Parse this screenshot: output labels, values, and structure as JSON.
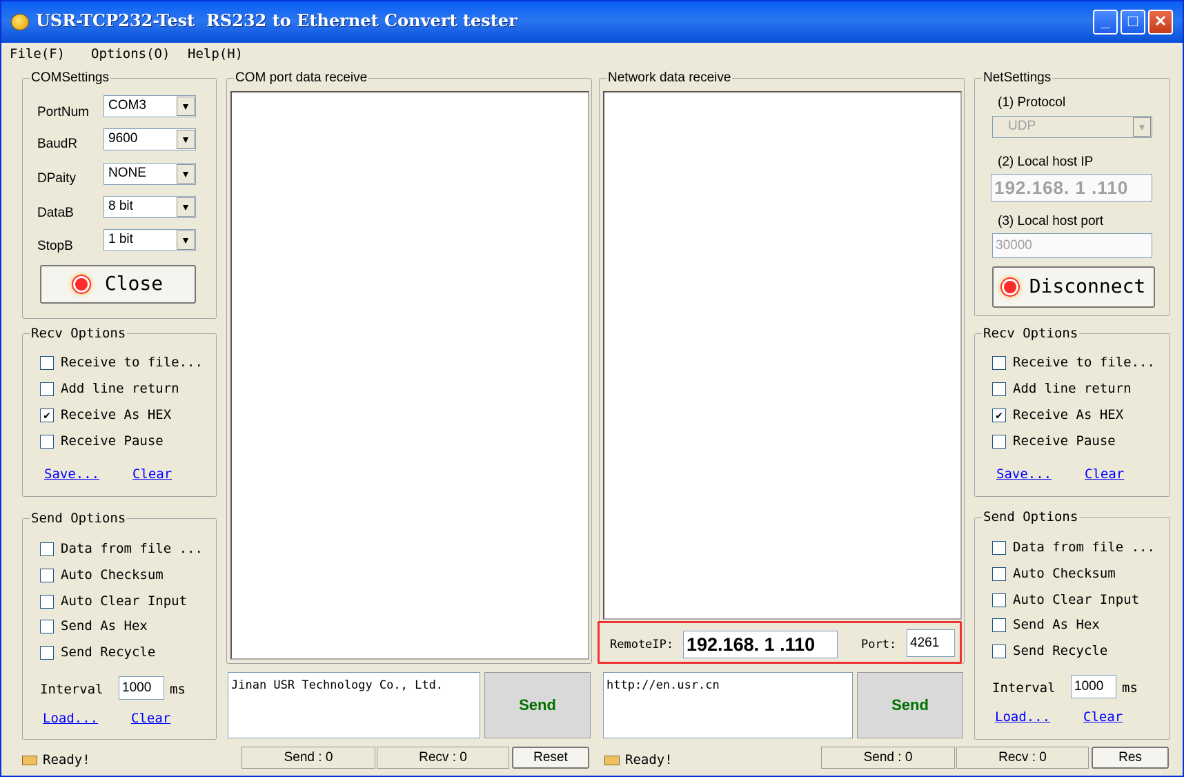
{
  "window": {
    "title": "USR-TCP232-Test  RS232 to Ethernet Convert tester",
    "minimize": "_",
    "maximize": "□",
    "close": "✕"
  },
  "menu": [
    "File(F)",
    "Options(O)",
    "Help(H)"
  ],
  "com_settings": {
    "legend": "COMSettings",
    "fields": [
      {
        "label": "PortNum",
        "value": "COM3"
      },
      {
        "label": "BaudR",
        "value": "9600"
      },
      {
        "label": "DPaity",
        "value": "NONE"
      },
      {
        "label": "DataB",
        "value": "8 bit"
      },
      {
        "label": "StopB",
        "value": "1 bit"
      }
    ],
    "button": "Close"
  },
  "com_recv_options": {
    "legend": "Recv Options",
    "items": [
      {
        "label": "Receive to file...",
        "checked": false
      },
      {
        "label": "Add line return",
        "checked": false
      },
      {
        "label": "Receive As HEX",
        "checked": true
      },
      {
        "label": "Receive Pause",
        "checked": false
      }
    ],
    "save": "Save...",
    "clear": "Clear"
  },
  "com_send_options": {
    "legend": "Send Options",
    "items": [
      {
        "label": "Data from file ...",
        "checked": false
      },
      {
        "label": "Auto Checksum",
        "checked": false
      },
      {
        "label": "Auto Clear Input",
        "checked": false
      },
      {
        "label": "Send As Hex",
        "checked": false
      },
      {
        "label": "Send Recycle",
        "checked": false
      }
    ],
    "interval_label": "Interval",
    "interval_value": "1000",
    "interval_unit": "ms",
    "load": "Load...",
    "clear": "Clear"
  },
  "com_receive": {
    "legend": "COM port data receive"
  },
  "net_receive": {
    "legend": "Network data receive"
  },
  "com_send": {
    "text": "Jinan USR Technology Co., Ltd.",
    "button": "Send"
  },
  "net_send": {
    "text": "http://en.usr.cn",
    "button": "Send"
  },
  "remote": {
    "ip_label": "RemoteIP:",
    "ip_value": "192.168. 1 .110",
    "port_label": "Port:",
    "port_value": "4261"
  },
  "net_settings": {
    "legend": "NetSettings",
    "protocol_label": "(1) Protocol",
    "protocol_value": "UDP",
    "host_ip_label": "(2) Local host IP",
    "host_ip_parts": [
      "192",
      "168",
      "1",
      "110"
    ],
    "host_port_label": "(3) Local host port",
    "host_port_value": "30000",
    "button": "Disconnect"
  },
  "net_recv_options": {
    "legend": "Recv Options",
    "items": [
      {
        "label": "Receive to file...",
        "checked": false
      },
      {
        "label": "Add line return",
        "checked": false
      },
      {
        "label": "Receive As HEX",
        "checked": true
      },
      {
        "label": "Receive Pause",
        "checked": false
      }
    ],
    "save": "Save...",
    "clear": "Clear"
  },
  "net_send_options": {
    "legend": "Send Options",
    "items": [
      {
        "label": "Data from file ...",
        "checked": false
      },
      {
        "label": "Auto Checksum",
        "checked": false
      },
      {
        "label": "Auto Clear Input",
        "checked": false
      },
      {
        "label": "Send As Hex",
        "checked": false
      },
      {
        "label": "Send Recycle",
        "checked": false
      }
    ],
    "interval_label": "Interval",
    "interval_value": "1000",
    "interval_unit": "ms",
    "load": "Load...",
    "clear": "Clear"
  },
  "status_left": {
    "ready": "Ready!",
    "send": "Send : 0",
    "recv": "Recv : 0",
    "reset": "Reset"
  },
  "status_right": {
    "ready": "Ready!",
    "send": "Send : 0",
    "recv": "Recv : 0",
    "reset": "Res"
  },
  "colors": {
    "accent": "#0a5ef5",
    "highlight_box": "#ee3333",
    "send_text": "#007000",
    "link": "#0000ff"
  }
}
